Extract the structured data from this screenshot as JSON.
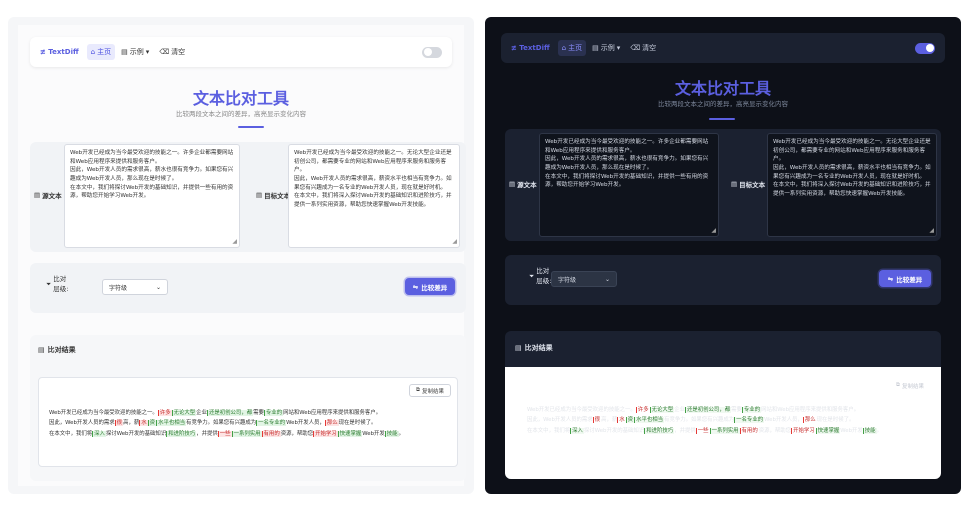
{
  "nav": {
    "brand": "≢ TextDiff",
    "home": "主页",
    "examples": "示例",
    "clear": "清空"
  },
  "header": {
    "title": "文本比对工具",
    "subtitle": "比较两段文本之间的差异，高亮显示变化内容"
  },
  "source": {
    "label": "源文本",
    "text": "Web开发已经成为当今最受欢迎的技能之一。许多企业都需要网站和Web应用程序来提供和服务客户。\n因此，Web开发人员的需求很高，薪水也很有竞争力。如果您有兴趣成为Web开发人员，那么现在是时候了。\n在本文中，我们将探讨Web开发的基础知识，并提供一些有用的资源，帮助您开始学习Web开发。"
  },
  "target": {
    "label": "目标文本",
    "text": "Web开发已经成为当今最受欢迎的技能之一。无论大型企业还是初创公司，都需要专业的网站和Web应用程序来服务和服务客户。\n因此，Web开发人员的需求很高，薪资水平也相当有竞争力。如果您有兴趣成为一名专业的Web开发人员，现在就是好时机。\n在本文中，我们将深入探讨Web开发的基础知识和进阶技巧，并提供一系列实用资源，帮助您快速掌握Web开发技能。"
  },
  "options": {
    "level_label": "比对层级:",
    "level_value": "字符级",
    "compare_button": "比较差异"
  },
  "result": {
    "heading": "比对结果",
    "copy_button": "复制结果",
    "line1": [
      {
        "t": "Web开发已经成为当今最受欢迎的技能之一。",
        "k": "s"
      },
      {
        "t": "许多",
        "k": "d"
      },
      {
        "t": "无论大型",
        "k": "i"
      },
      {
        "t": "企业",
        "k": "s"
      },
      {
        "t": "还是初创公司，都",
        "k": "i"
      },
      {
        "t": "需要",
        "k": "s"
      },
      {
        "t": "专业的",
        "k": "i"
      },
      {
        "t": "网站和Web应用程序来提供和服务客户。",
        "k": "s"
      }
    ],
    "line2": [
      {
        "t": "因此，Web开发人员的需求",
        "k": "s"
      },
      {
        "t": "很",
        "k": "d"
      },
      {
        "t": "高，薪",
        "k": "s"
      },
      {
        "t": "水",
        "k": "d"
      },
      {
        "t": "资",
        "k": "i"
      },
      {
        "t": "水平也相当",
        "k": "i"
      },
      {
        "t": "有竞争力。如果您有兴趣成为",
        "k": "s"
      },
      {
        "t": "一名专业的",
        "k": "i"
      },
      {
        "t": "Web开发人员，",
        "k": "s"
      },
      {
        "t": "那么",
        "k": "d"
      },
      {
        "t": "现在是时候了。",
        "k": "s"
      }
    ],
    "line3": [
      {
        "t": "在本文中，我们将",
        "k": "s"
      },
      {
        "t": "深入",
        "k": "i"
      },
      {
        "t": "探讨Web开发的基础知识",
        "k": "s"
      },
      {
        "t": "和进阶技巧",
        "k": "i"
      },
      {
        "t": "，并提供",
        "k": "s"
      },
      {
        "t": "一些",
        "k": "d"
      },
      {
        "t": "一系列实用",
        "k": "i"
      },
      {
        "t": "有用的",
        "k": "d"
      },
      {
        "t": "资源，帮助您",
        "k": "s"
      },
      {
        "t": "开始学习",
        "k": "d"
      },
      {
        "t": "快速掌握",
        "k": "i"
      },
      {
        "t": "Web开发",
        "k": "s"
      },
      {
        "t": "技能",
        "k": "i"
      },
      {
        "t": "。",
        "k": "s"
      }
    ]
  },
  "colors": {
    "accent": "#5b5fe0",
    "deleted": "#c62828",
    "inserted": "#2e7d32"
  }
}
